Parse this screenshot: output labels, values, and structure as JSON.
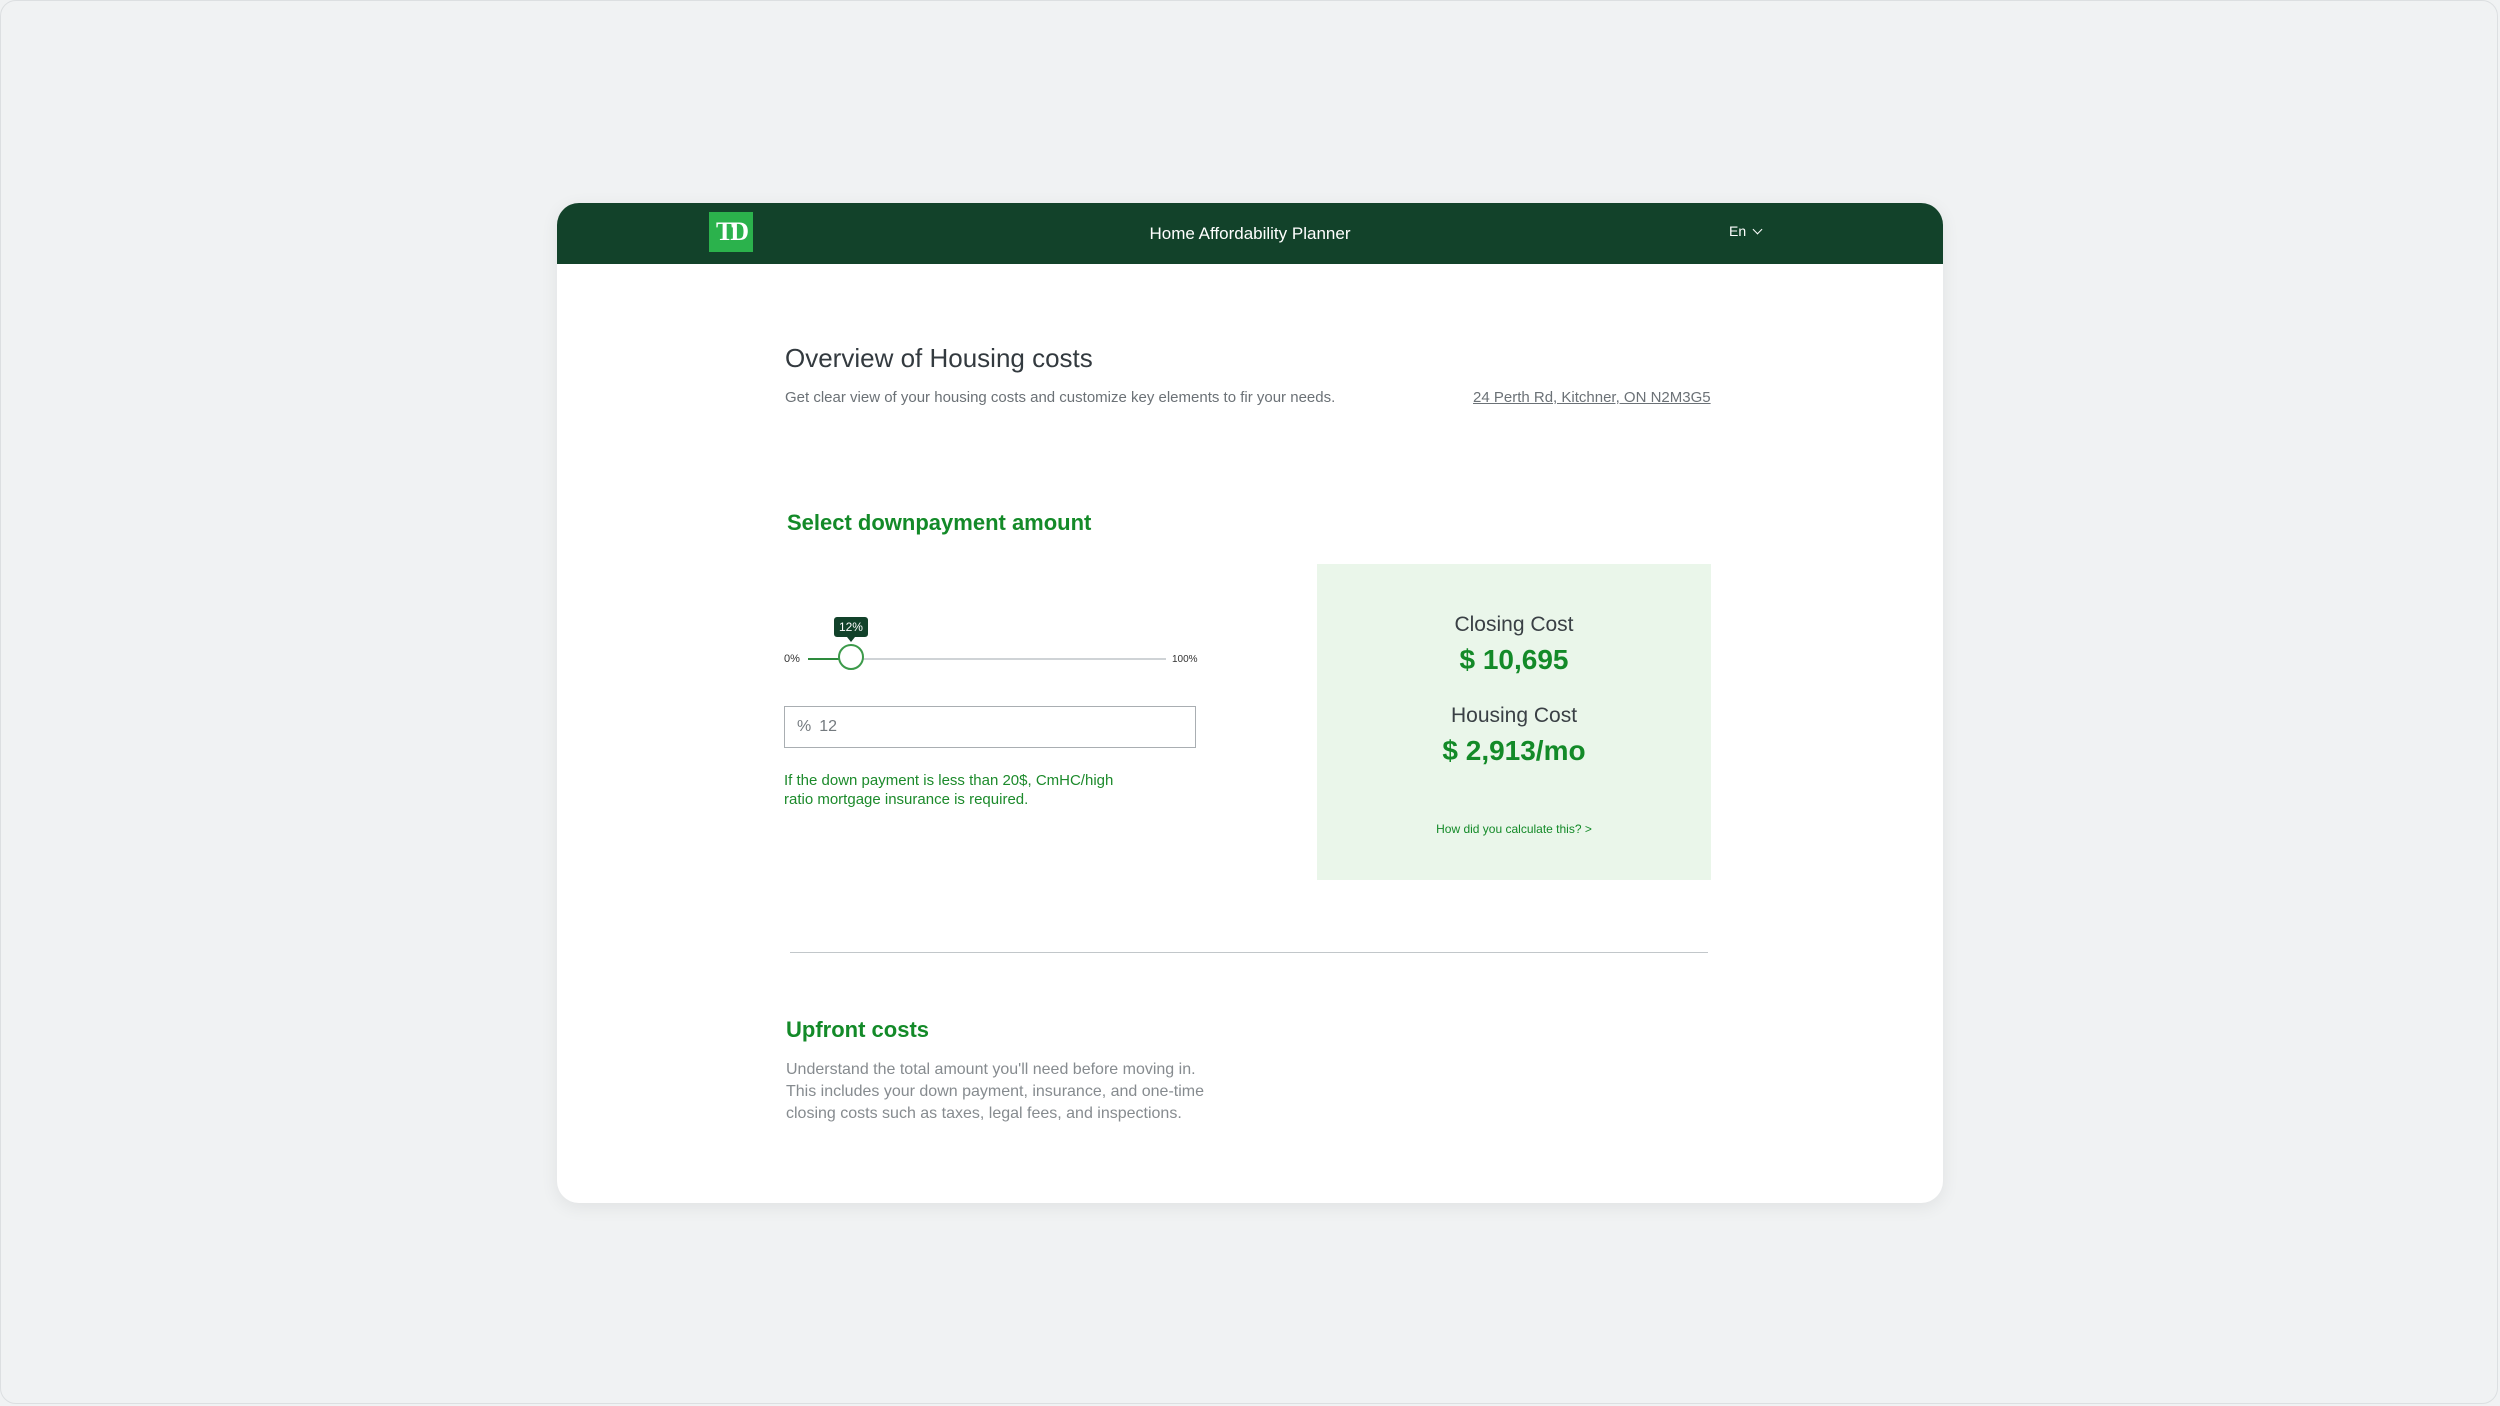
{
  "header": {
    "logo_text": "TD",
    "title": "Home Affordability Planner",
    "language": "En"
  },
  "overview": {
    "title": "Overview of Housing costs",
    "subtitle": "Get clear view of your housing costs and customize key elements to fir your needs.",
    "address": "24 Perth Rd, Kitchner, ON N2M3G5"
  },
  "downpayment": {
    "heading": "Select downpayment amount",
    "slider": {
      "min_label": "0%",
      "max_label": "100%",
      "value": 12,
      "value_label": "12%"
    },
    "input_prefix": "%",
    "input_value": "12",
    "note": "If the down payment is less than 20$, CmHC/high ratio mortgage insurance is required."
  },
  "summary": {
    "closing_label": "Closing Cost",
    "closing_value": "$ 10,695",
    "housing_label": "Housing Cost",
    "housing_value": "$ 2,913/mo",
    "calc_link": "How did you calculate this? >"
  },
  "upfront": {
    "heading": "Upfront costs",
    "description": "Understand the total amount you'll need before moving in. This includes your down payment, insurance, and one-time closing costs such as taxes, legal fees, and inspections."
  },
  "colors": {
    "brand_dark": "#12422a",
    "brand_logo": "#2bb24c",
    "accent_green": "#138a28",
    "card_bg": "#eaf6ea"
  }
}
